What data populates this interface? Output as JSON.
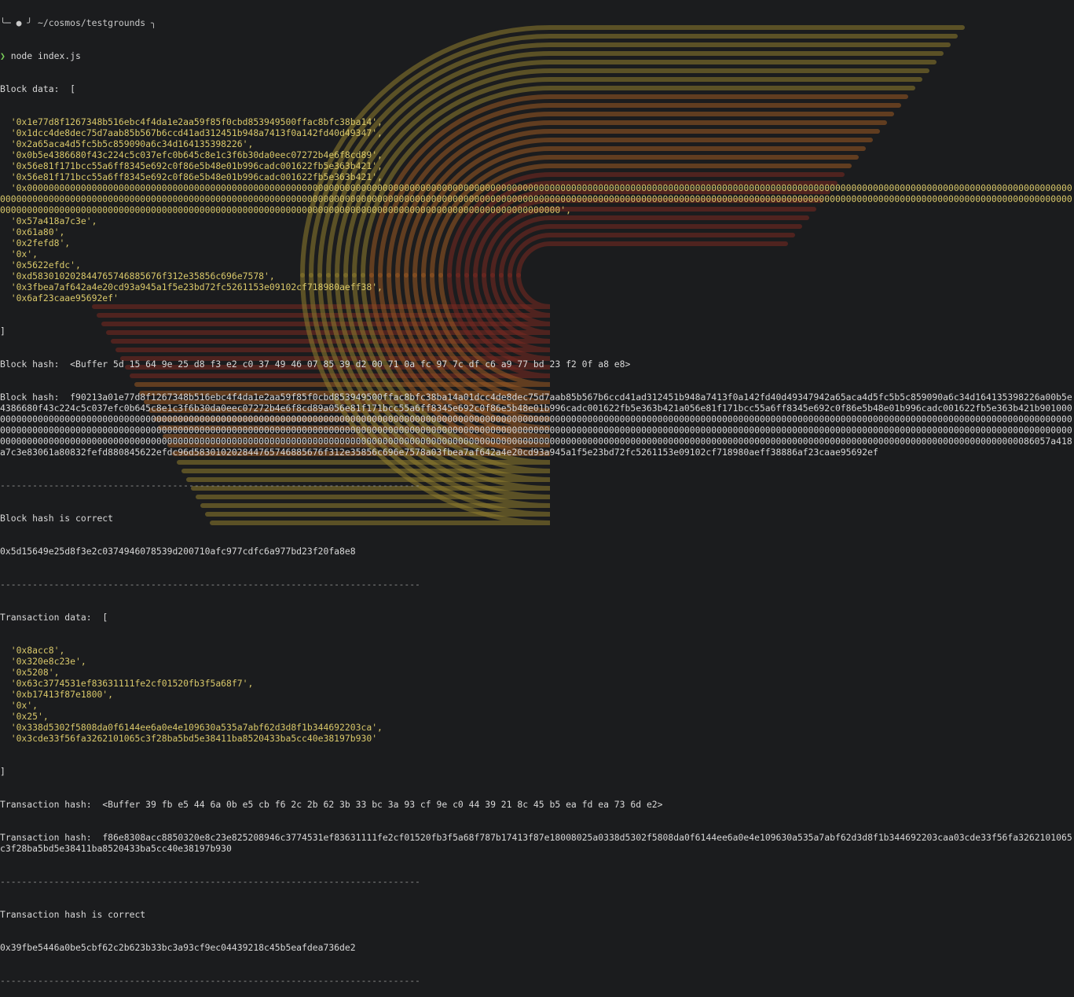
{
  "top_bar": {
    "fragment": "╰─ ● ╯ ~/cosmos/testgrounds ╮"
  },
  "prompt": {
    "symbol": "❯",
    "command": "node index.js"
  },
  "block": {
    "data_label": "Block data:",
    "open_bracket": "[",
    "close_bracket": "]",
    "items": [
      "'0x1e77d8f1267348b516ebc4f4da1e2aa59f85f0cbd853949500ffac8bfc38ba14',",
      "'0x1dcc4de8dec75d7aab85b567b6ccd41ad312451b948a7413f0a142fd40d49347',",
      "'0x2a65aca4d5fc5b5c859090a6c34d164135398226',",
      "'0x0b5e4386680f43c224c5c037efc0b645c8e1c3f6b30da0eec07272b4e6f8cd89',",
      "'0x56e81f171bcc55a6ff8345e692c0f86e5b48e01b996cadc001622fb5e363b421',",
      "'0x56e81f171bcc55a6ff8345e692c0f86e5b48e01b996cadc001622fb5e363b421',",
      "'0x00000000000000000000000000000000000000000000000000000000000000000000000000000000000000000000000000000000000000000000000000000000000000000000000000000000000000000000000000000000000000000000000000000000000000000000000000000000000000000000000000000000000000000000000000000000000000000000000000000000000000000000000000000000000000000000000000000000000000000000000000000000000000000000000000000000000000000000000000000000000000000000000000000000000000000000000000000000000000000000000000000000000000000',",
      "'0x57a418a7c3e',",
      "'0x61a80',",
      "'0x2fefd8',",
      "'0x',",
      "'0x5622efdc',",
      "'0xd583010202844765746885676f312e35856c696e7578',",
      "'0x3fbea7af642a4e20cd93a945a1f5e23bd72fc5261153e09102cf718980aeff38',",
      "'0x6af23caae95692ef'"
    ],
    "buffer_label": "Block hash:",
    "buffer_value": "<Buffer 5d 15 64 9e 25 d8 f3 e2 c0 37 49 46 07 85 39 d2 00 71 0a fc 97 7c df c6 a9 77 bd 23 f2 0f a8 e8>",
    "rlp_label": "Block hash:",
    "rlp_value": "f90213a01e77d8f1267348b516ebc4f4da1e2aa59f85f0cbd853949500ffac8bfc38ba14a01dcc4de8dec75d7aab85b567b6ccd41ad312451b948a7413f0a142fd40d49347942a65aca4d5fc5b5c859090a6c34d164135398226a00b5e4386680f43c224c5c037efc0b645c8e1c3f6b30da0eec07272b4e6f8cd89a056e81f171bcc55a6ff8345e692c0f86e5b48e01b996cadc001622fb5e363b421a056e81f171bcc55a6ff8345e692c0f86e5b48e01b996cadc001622fb5e363b421b90100000000000000000000000000000000000000000000000000000000000000000000000000000000000000000000000000000000000000000000000000000000000000000000000000000000000000000000000000000000000000000000000000000000000000000000000000000000000000000000000000000000000000000000000000000000000000000000000000000000000000000000000000000000000000000000000000000000000000000000000000000000000000000000000000000000000000000000000000000000000000000000000000000000000000000000000000000000000000000000000000000000000000000000000000000000000000000000000000000000000000000000000000000000000000000000000000000000000000086057a418a7c3e83061a80832fefd880845622efdc96d583010202844765746885676f312e35856c696e7578a03fbea7af642a4e20cd93a945a1f5e23bd72fc5261153e09102cf718980aeff38886af23caae95692ef",
    "correct_msg": "Block hash is correct",
    "hash": "0x5d15649e25d8f3e2c0374946078539d200710afc977cdfc6a977bd23f20fa8e8"
  },
  "separator": "------------------------------------------------------------------------------",
  "tx": {
    "data_label": "Transaction data:",
    "open_bracket": "[",
    "close_bracket": "]",
    "items": [
      "'0x8acc8',",
      "'0x320e8c23e',",
      "'0x5208',",
      "'0x63c3774531ef83631111fe2cf01520fb3f5a68f7',",
      "'0xb17413f87e1800',",
      "'0x',",
      "'0x25',",
      "'0x338d5302f5808da0f6144ee6a0e4e109630a535a7abf62d3d8f1b344692203ca',",
      "'0x3cde33f56fa3262101065c3f28ba5bd5e38411ba8520433ba5cc40e38197b930'"
    ],
    "buffer_label": "Transaction hash:",
    "buffer_value": "<Buffer 39 fb e5 44 6a 0b e5 cb f6 2c 2b 62 3b 33 bc 3a 93 cf 9e c0 44 39 21 8c 45 b5 ea fd ea 73 6d e2>",
    "rlp_label": "Transaction hash:",
    "rlp_value": "f86e8308acc8850320e8c23e825208946c3774531ef83631111fe2cf01520fb3f5a68f787b17413f87e18008025a0338d5302f5808da0f6144ee6a0e4e109630a535a7abf62d3d8f1b344692203caa03cde33f56fa3262101065c3f28ba5bd5e38411ba8520433ba5cc40e38197b930",
    "correct_msg": "Transaction hash is correct",
    "hash": "0x39fbe5446a0be5cbf62c2b623b33bc3a93cf9ec04439218c45b5eafdea736de2"
  },
  "colors": {
    "background": "#1b1c1e",
    "string": "#d9c86a",
    "prompt": "#7bd15a",
    "text": "#d8d8d8",
    "wallpaper_red": "#7a2a20",
    "wallpaper_orange": "#9a5a22",
    "wallpaper_yellow": "#8f7d2e"
  }
}
